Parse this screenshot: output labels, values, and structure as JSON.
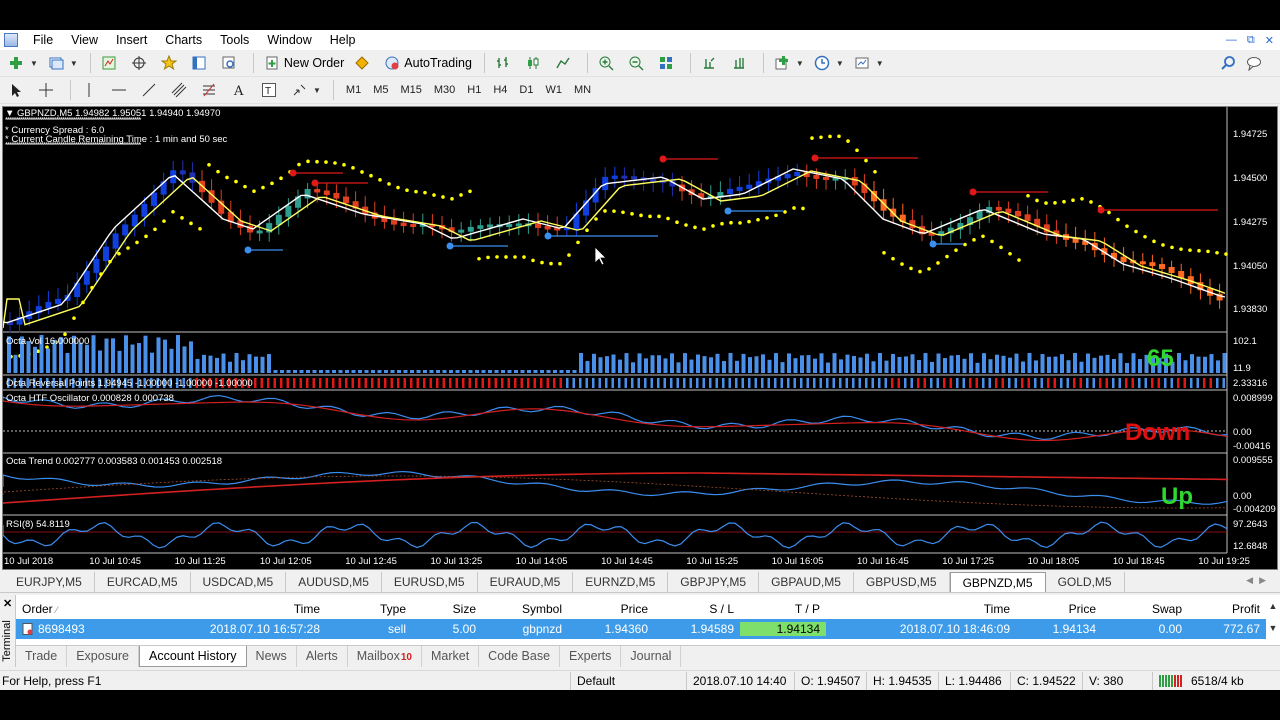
{
  "menu": [
    "File",
    "View",
    "Insert",
    "Charts",
    "Tools",
    "Window",
    "Help"
  ],
  "toolbar": {
    "new_order": "New Order",
    "autotrading": "AutoTrading",
    "timeframes": [
      "M1",
      "M5",
      "M15",
      "M30",
      "H1",
      "H4",
      "D1",
      "W1",
      "MN"
    ]
  },
  "chart": {
    "symbol_header": "GBPNZD,M5  1.94982 1.95051 1.94940 1.94970",
    "info_line1": "*   Currency Spread : 6.0",
    "info_line2": "*   Current Candle Remaining Time : 1 min and 50 sec",
    "price_labels": [
      "1.94725",
      "1.94500",
      "1.94275",
      "1.94050",
      "1.93830"
    ],
    "panels": {
      "vol": {
        "label": "Octa Vol 16.000000",
        "max": "102.1",
        "min": "11.9",
        "value_text": "65"
      },
      "reversal": {
        "label": "Octa Reversal Points 1.94945 -1.00000 -1.00000 -1.00000",
        "value": "2.33316"
      },
      "htf": {
        "label": "Octa HTF Oscillator 0.000828 0.000738",
        "max": "0.008999",
        "zero": "0.00",
        "min": "-0.00416",
        "signal": "Down"
      },
      "trend": {
        "label": "Octa Trend 0.002777 0.003583 0.001453 0.002518",
        "max": "0.009555",
        "zero": "0.00",
        "min": "-0.004209",
        "signal": "Up"
      },
      "rsi": {
        "label": "RSI(8) 54.8119",
        "max": "97.2643",
        "min": "12.6848"
      }
    },
    "time_labels": [
      "10 Jul 2018",
      "10 Jul 10:45",
      "10 Jul 11:25",
      "10 Jul 12:05",
      "10 Jul 12:45",
      "10 Jul 13:25",
      "10 Jul 14:05",
      "10 Jul 14:45",
      "10 Jul 15:25",
      "10 Jul 16:05",
      "10 Jul 16:45",
      "10 Jul 17:25",
      "10 Jul 18:05",
      "10 Jul 18:45",
      "10 Jul 19:25"
    ]
  },
  "symbol_tabs": [
    "EURJPY,M5",
    "EURCAD,M5",
    "USDCAD,M5",
    "AUDUSD,M5",
    "EURUSD,M5",
    "EURAUD,M5",
    "EURNZD,M5",
    "GBPJPY,M5",
    "GBPAUD,M5",
    "GBPUSD,M5",
    "GBPNZD,M5",
    "GOLD,M5"
  ],
  "active_symbol_tab": "GBPNZD,M5",
  "terminal": {
    "side_label": "Terminal",
    "columns": [
      "Order",
      "Time",
      "Type",
      "Size",
      "Symbol",
      "Price",
      "S / L",
      "T / P",
      "Time",
      "Price",
      "Swap",
      "Profit"
    ],
    "row": {
      "order": "8698493",
      "open_time": "2018.07.10 16:57:28",
      "type": "sell",
      "size": "5.00",
      "symbol": "gbpnzd",
      "price": "1.94360",
      "sl": "1.94589",
      "tp": "1.94134",
      "close_time": "2018.07.10 18:46:09",
      "close_price": "1.94134",
      "swap": "0.00",
      "profit": "772.67"
    },
    "tabs": [
      "Trade",
      "Exposure",
      "Account History",
      "News",
      "Alerts",
      "Mailbox",
      "Market",
      "Code Base",
      "Experts",
      "Journal"
    ],
    "active_tab": "Account History",
    "mailbox_count": "10"
  },
  "status": {
    "help": "For Help, press F1",
    "profile": "Default",
    "datetime": "2018.07.10 14:40",
    "open": "O: 1.94507",
    "high": "H: 1.94535",
    "low": "L: 1.94486",
    "close": "C: 1.94522",
    "volume": "V: 380",
    "traffic": "6518/4 kb"
  },
  "colors": {
    "bull_candle": "#2e9e8e",
    "bear_candle": "#e04020",
    "blue_bar": "#1040e0",
    "orange_bar": "#ff6a20",
    "ma_yellow": "#ffff60",
    "ma_white": "#ffffff",
    "psar": "#ffff00",
    "selection": "#3d9be9",
    "tp_highlight": "#7ee06a"
  }
}
